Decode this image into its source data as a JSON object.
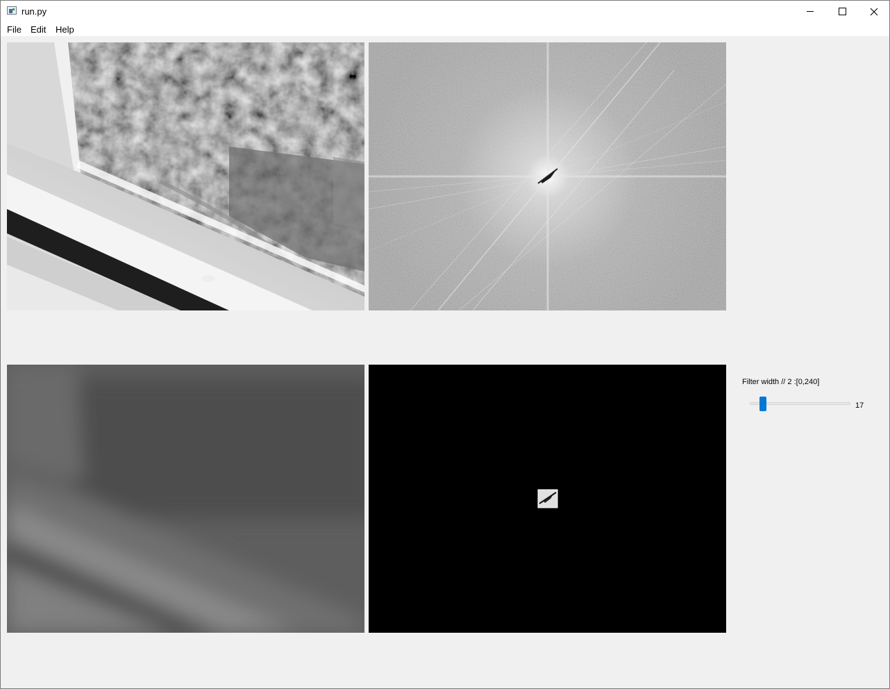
{
  "window": {
    "title": "run.py",
    "icon": "python-app-icon"
  },
  "menubar": {
    "items": [
      {
        "label": "File"
      },
      {
        "label": "Edit"
      },
      {
        "label": "Help"
      }
    ]
  },
  "views": {
    "original": {
      "content": "grayscale camera image of a window frame with trees outside"
    },
    "spectrum": {
      "content": "fourier magnitude spectrum with bright center and radial streaks"
    },
    "filtered": {
      "content": "low-pass filtered blurry grayscale image"
    },
    "masked_spectrum": {
      "content": "black spectrum with small square window kept at center"
    }
  },
  "controls": {
    "filter_label": "Filter width // 2 :[0,240]",
    "filter_min": 0,
    "filter_max": 240,
    "filter_value": 17,
    "filter_value_text": "17",
    "accent_color": "#0078d7"
  }
}
